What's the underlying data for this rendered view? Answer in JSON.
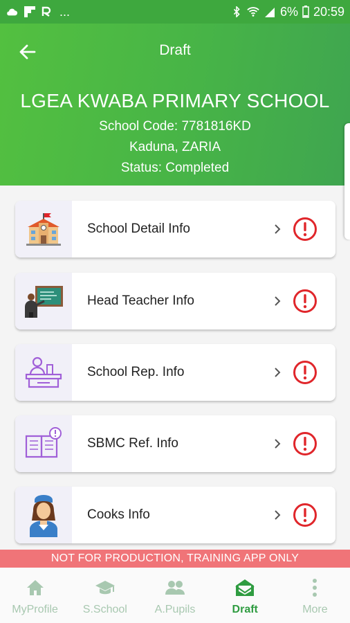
{
  "status_bar": {
    "battery": "6%",
    "time": "20:59",
    "more": "..."
  },
  "header": {
    "title": "Draft",
    "school_name": "LGEA KWABA PRIMARY SCHOOL",
    "school_code": "School Code: 7781816KD",
    "location": "Kaduna, ZARIA",
    "status": "Status: Completed"
  },
  "sections": [
    {
      "label": "School Detail Info"
    },
    {
      "label": "Head Teacher Info"
    },
    {
      "label": "School Rep. Info"
    },
    {
      "label": "SBMC Ref. Info"
    },
    {
      "label": "Cooks Info"
    }
  ],
  "banner": "NOT FOR PRODUCTION, TRAINING APP ONLY",
  "bottom_nav": [
    {
      "label": "MyProfile",
      "icon": "home-icon"
    },
    {
      "label": "S.School",
      "icon": "graduation-cap-icon"
    },
    {
      "label": "A.Pupils",
      "icon": "people-icon"
    },
    {
      "label": "Draft",
      "icon": "envelope-open-icon",
      "active": true
    },
    {
      "label": "More",
      "icon": "more-vertical-icon"
    }
  ],
  "colors": {
    "header": "#47b447",
    "alert": "#e0262b",
    "banner": "#f07478",
    "nav_active": "#2f9c41"
  }
}
